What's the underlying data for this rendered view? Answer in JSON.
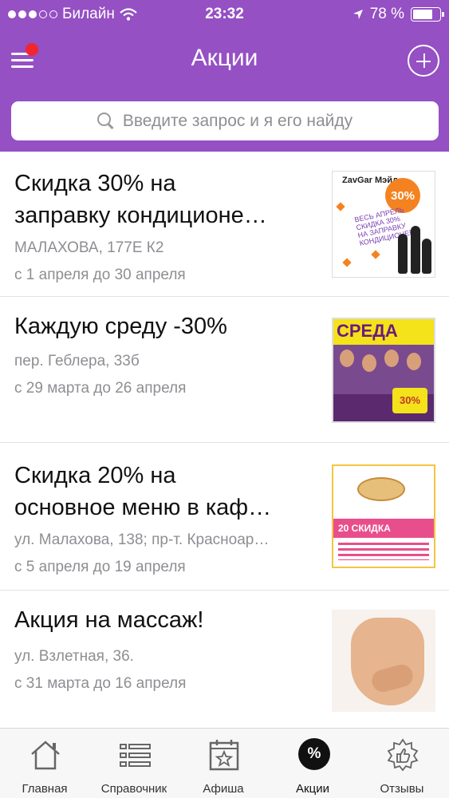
{
  "status_bar": {
    "carrier": "Билайн",
    "time": "23:32",
    "battery": "78 %",
    "battery_level": 0.78
  },
  "nav": {
    "title": "Акции"
  },
  "search": {
    "placeholder": "Введите запрос и я его найду"
  },
  "promos": [
    {
      "title_line1": "Скидка 30% на",
      "title_line2": "заправку кондиционе…",
      "address": "МАЛАХОВА, 177Е К2",
      "dates": "с 1 апреля до 30 апреля",
      "thumb_logo": "ZavGar Мэйд",
      "thumb_badge": "30%",
      "thumb_text": "ВЕСЬ АПРЕЛЬ СКИДКА 30% НА ЗАПРАВКУ КОНДИЦИОНЕРА"
    },
    {
      "title_line1": "Каждую среду -30%",
      "address": "пер. Геблера, 33б",
      "dates": "с 29 марта до 26 апреля",
      "thumb_heading": "СРЕДА",
      "thumb_badge": "30%"
    },
    {
      "title_line1": "Скидка 20% на",
      "title_line2": "основное меню в каф…",
      "address": "ул. Малахова, 138; пр-т. Красноар…",
      "dates": "с 5 апреля до 19 апреля",
      "thumb_strip": "20 СКИДКА"
    },
    {
      "title_line1": "Акция на массаж!",
      "address": "ул. Взлетная, 36.",
      "dates": "с 31 марта до 16 апреля"
    }
  ],
  "tabs": [
    {
      "label": "Главная",
      "icon": "home-icon"
    },
    {
      "label": "Справочник",
      "icon": "list-icon"
    },
    {
      "label": "Афиша",
      "icon": "calendar-star-icon"
    },
    {
      "label": "Акции",
      "icon": "percent-icon",
      "active": true
    },
    {
      "label": "Отзывы",
      "icon": "thumbs-up-icon"
    }
  ],
  "colors": {
    "header": "#9550c4",
    "badge": "#f2262e",
    "secondary_text": "#8e8e93"
  }
}
